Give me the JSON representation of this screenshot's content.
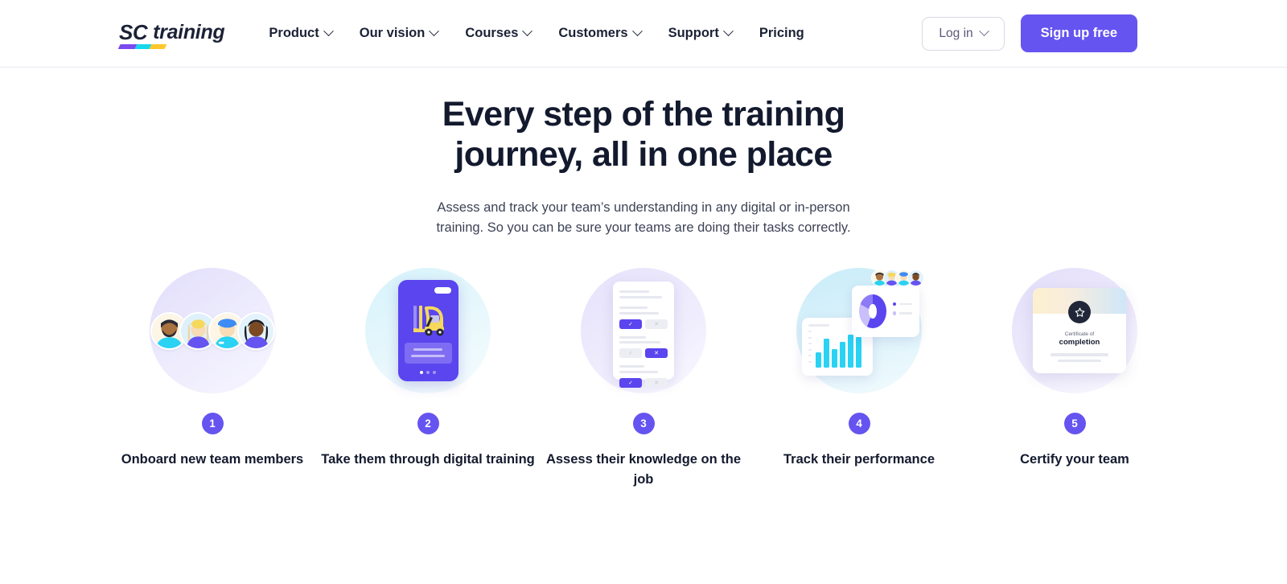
{
  "brand": {
    "logo_mark": "SC",
    "logo_word": "training",
    "accent_purple": "#6554f0",
    "accent_cyan": "#2ad2f4",
    "accent_yellow": "#ffc72c",
    "text_dark": "#131a2e"
  },
  "nav": {
    "items": [
      {
        "label": "Product",
        "has_chevron": true
      },
      {
        "label": "Our vision",
        "has_chevron": true
      },
      {
        "label": "Courses",
        "has_chevron": true
      },
      {
        "label": "Customers",
        "has_chevron": true
      },
      {
        "label": "Support",
        "has_chevron": true
      },
      {
        "label": "Pricing",
        "has_chevron": false
      }
    ]
  },
  "header_actions": {
    "login_label": "Log in",
    "signup_label": "Sign up free"
  },
  "hero": {
    "heading": "Every step of the training journey, all in one place",
    "subheading": "Assess and track your team’s understanding in any digital or in-person training. So you can be sure your teams are doing their tasks correctly."
  },
  "steps": [
    {
      "number": "1",
      "caption": "Onboard new team members",
      "art": "team-avatars"
    },
    {
      "number": "2",
      "caption": "Take them through digital training",
      "art": "mobile-training-phone"
    },
    {
      "number": "3",
      "caption": "Assess their knowledge on the job",
      "art": "assessment-checklist"
    },
    {
      "number": "4",
      "caption": "Track their performance",
      "art": "analytics-dashboard"
    },
    {
      "number": "5",
      "caption": "Certify your team",
      "art": "completion-certificate"
    }
  ],
  "certificate": {
    "subtitle": "Certificate of",
    "title": "completion"
  }
}
